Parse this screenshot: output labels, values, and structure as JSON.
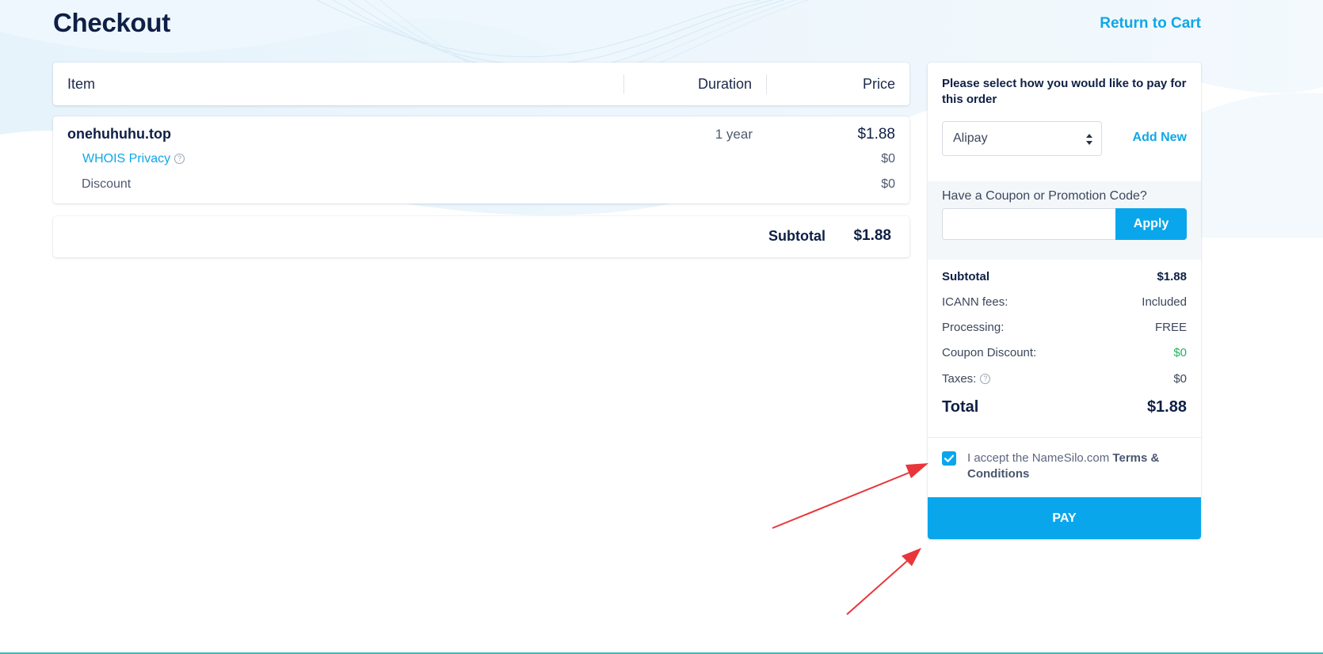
{
  "header": {
    "title": "Checkout",
    "return_link": "Return to Cart"
  },
  "table": {
    "columns": [
      "Item",
      "Duration",
      "Price"
    ]
  },
  "order_item": {
    "name": "onehuhuhu.top",
    "duration": "1 year",
    "price": "$1.88",
    "addons": [
      {
        "label": "WHOIS Privacy",
        "price": "$0"
      },
      {
        "label": "Discount",
        "price": "$0"
      }
    ]
  },
  "subtotal": {
    "label": "Subtotal",
    "value": "$1.88"
  },
  "payment": {
    "heading": "Please select how you would like to pay for this order",
    "selected_method": "Alipay",
    "add_new": "Add New"
  },
  "coupon": {
    "label": "Have a Coupon or Promotion Code?",
    "value": "",
    "apply": "Apply"
  },
  "summary": {
    "rows": [
      {
        "label": "Subtotal",
        "value": "$1.88"
      },
      {
        "label": "ICANN fees:",
        "value": "Included"
      },
      {
        "label": "Processing:",
        "value": "FREE"
      },
      {
        "label": "Coupon Discount:",
        "value": "$0"
      },
      {
        "label": "Taxes:",
        "value": "$0"
      }
    ],
    "total_label": "Total",
    "total_value": "$1.88"
  },
  "terms": {
    "checked": true,
    "prefix": "I accept the NameSilo.com",
    "link": "Terms & Conditions"
  },
  "pay_button": "PAY",
  "colors": {
    "accent": "#0aa6ec",
    "heading": "#0f1f45",
    "discount_green": "#22b463",
    "annotation_arrow": "#e8363a"
  },
  "icons": {
    "help": "question-circle-icon",
    "select": "chevron-up-down-icon",
    "check": "checkmark-icon"
  }
}
